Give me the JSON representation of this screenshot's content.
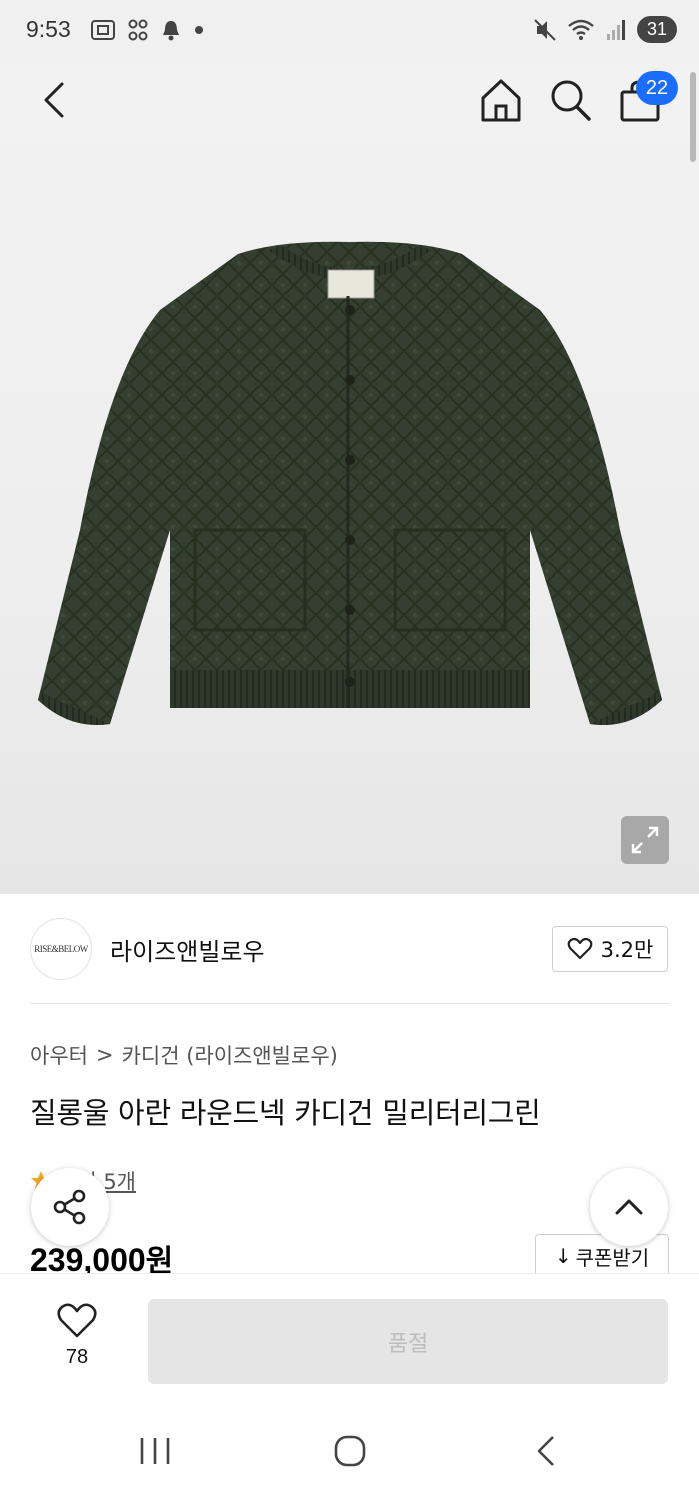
{
  "status_bar": {
    "time": "9:53",
    "battery": "31"
  },
  "header": {
    "cart_count": "22"
  },
  "brand": {
    "logo_text": "RISE&BELOW",
    "name": "라이즈앤빌로우",
    "likes": "3.2만"
  },
  "breadcrumb": {
    "category": "아우터",
    "separator": ">",
    "subcategory": "카디건 (라이즈앤빌로우)"
  },
  "product": {
    "title": "질롱울 아란 라운드넥 카디건 밀리터리그린",
    "reviews": "후기 5개",
    "price_number": "239,000",
    "price_unit": "원",
    "coupon_label": "쿠폰받기",
    "coupon_icon": "↓"
  },
  "bottom": {
    "wish_count": "78",
    "buy_label": "품절"
  },
  "colors": {
    "cart_badge": "#1a6dff",
    "product_green": "#2f3a2c",
    "soldout_bg": "#e5e5e5"
  }
}
